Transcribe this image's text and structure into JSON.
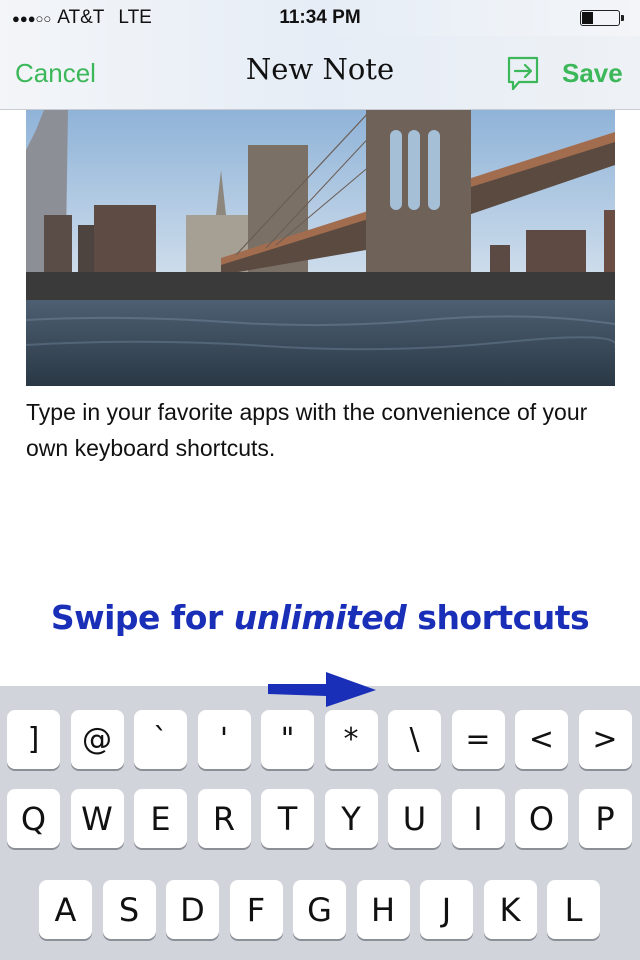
{
  "status_bar": {
    "signal": "●●●○○",
    "carrier": "AT&T",
    "network": "LTE",
    "time": "11:34 PM",
    "battery_level": 0.3
  },
  "nav": {
    "cancel_label": "Cancel",
    "title": "New Note",
    "share_icon": "share-arrow-bubble-icon",
    "save_label": "Save",
    "accent_color": "#3cb85a"
  },
  "note": {
    "image_description": "Brooklyn Bridge and Manhattan skyline over the East River",
    "text": "Type in your favorite apps with the convenience of your own keyboard shortcuts."
  },
  "promo": {
    "prefix": "Swipe for ",
    "emphasis": "unlimited",
    "suffix": " shortcuts",
    "color": "#1a2fb8",
    "arrow_icon": "right-arrow-icon"
  },
  "keyboard": {
    "row1": [
      "]",
      "@",
      "`",
      "'",
      "\"",
      "*",
      "\\",
      "=",
      "<",
      ">"
    ],
    "row2": [
      "Q",
      "W",
      "E",
      "R",
      "T",
      "Y",
      "U",
      "I",
      "O",
      "P"
    ],
    "row3": [
      "A",
      "S",
      "D",
      "F",
      "G",
      "H",
      "J",
      "K",
      "L"
    ]
  }
}
